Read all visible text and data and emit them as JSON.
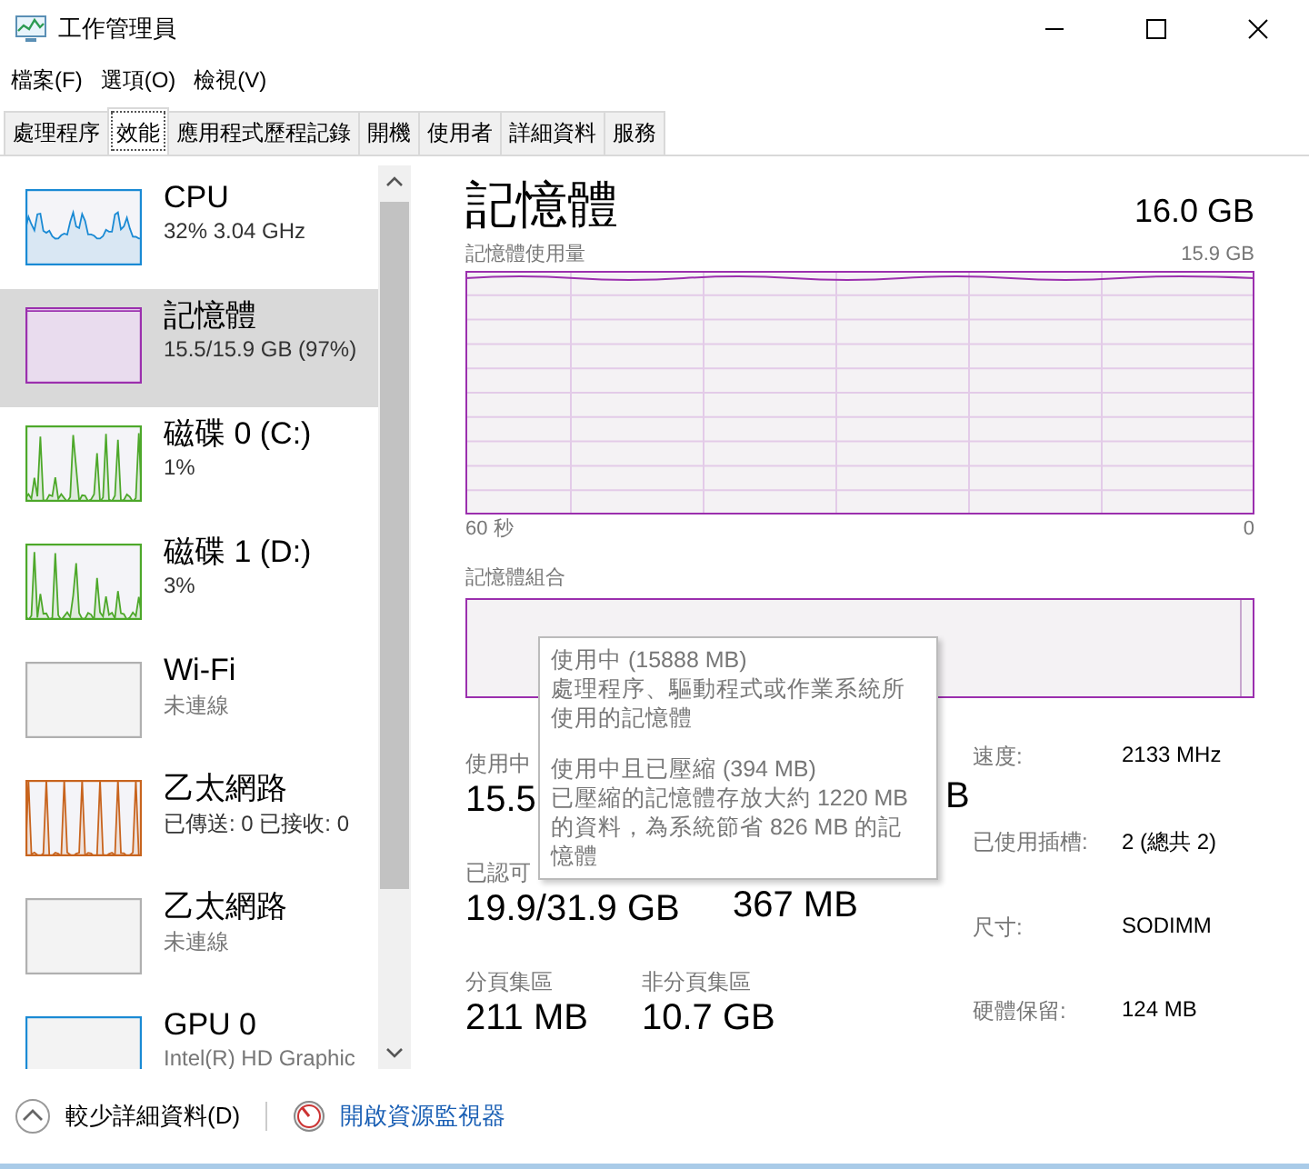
{
  "window": {
    "title": "工作管理員"
  },
  "menu": [
    "檔案(F)",
    "選項(O)",
    "檢視(V)"
  ],
  "tabs": [
    {
      "label": "處理程序",
      "selected": false
    },
    {
      "label": "效能",
      "selected": true
    },
    {
      "label": "應用程式歷程記錄",
      "selected": false
    },
    {
      "label": "開機",
      "selected": false
    },
    {
      "label": "使用者",
      "selected": false
    },
    {
      "label": "詳細資料",
      "selected": false
    },
    {
      "label": "服務",
      "selected": false
    }
  ],
  "sidebar": {
    "items": [
      {
        "name": "CPU",
        "detail": "32% 3.04 GHz",
        "color": "#1a8ad4",
        "kind": "graph",
        "selected": false
      },
      {
        "name": "記憶體",
        "detail": "15.5/15.9 GB (97%)",
        "color": "#9b2fae",
        "kind": "flat",
        "selected": true
      },
      {
        "name": "磁碟 0 (C:)",
        "detail": "1%",
        "color": "#4da82a",
        "kind": "spikes",
        "selected": false
      },
      {
        "name": "磁碟 1 (D:)",
        "detail": "3%",
        "color": "#4da82a",
        "kind": "spikes",
        "selected": false
      },
      {
        "name": "Wi-Fi",
        "detail": "未連線",
        "color": "#b0b0b0",
        "kind": "empty",
        "selected": false
      },
      {
        "name": "乙太網路",
        "detail": "已傳送: 0 已接收: 0",
        "color": "#c8641e",
        "kind": "bars",
        "selected": false
      },
      {
        "name": "乙太網路",
        "detail": "未連線",
        "color": "#b0b0b0",
        "kind": "empty",
        "selected": false
      },
      {
        "name": "GPU 0",
        "detail": "Intel(R) HD Graphic",
        "color": "#1a8ad4",
        "kind": "empty",
        "selected": false
      }
    ]
  },
  "detail": {
    "title": "記憶體",
    "total": "16.0 GB",
    "usage_label": "記憶體使用量",
    "usage_max": "15.9 GB",
    "time_start": "60 秒",
    "time_end": "0",
    "composition_label": "記憶體組合",
    "stats": [
      {
        "cells": [
          {
            "label": "使用中",
            "value": "15.5"
          },
          {
            "value": "B"
          }
        ]
      },
      {
        "cells": [
          {
            "label": "已認可",
            "value": "19.9/31.9 GB"
          },
          {
            "value": "367 MB"
          }
        ]
      },
      {
        "cells": [
          {
            "label": "分頁集區",
            "value": "211 MB"
          },
          {
            "label": "非分頁集區",
            "value": "10.7 GB"
          }
        ]
      }
    ],
    "specs": [
      {
        "label": "速度:",
        "value": "2133 MHz"
      },
      {
        "label": "已使用插槽:",
        "value": "2 (總共 2)"
      },
      {
        "label": "尺寸:",
        "value": "SODIMM"
      },
      {
        "label": "硬體保留:",
        "value": "124 MB"
      }
    ]
  },
  "tooltip": {
    "sections": [
      {
        "title": "使用中 (15888 MB)",
        "text": "處理程序、驅動程式或作業系統所使用的記憶體"
      },
      {
        "title": "使用中且已壓縮 (394 MB)",
        "text": "已壓縮的記憶體存放大約 1220 MB 的資料，為系統節省 826 MB 的記憶體"
      }
    ]
  },
  "footer": {
    "fewer_details": "較少詳細資料(D)",
    "open_monitor": "開啟資源監視器"
  }
}
